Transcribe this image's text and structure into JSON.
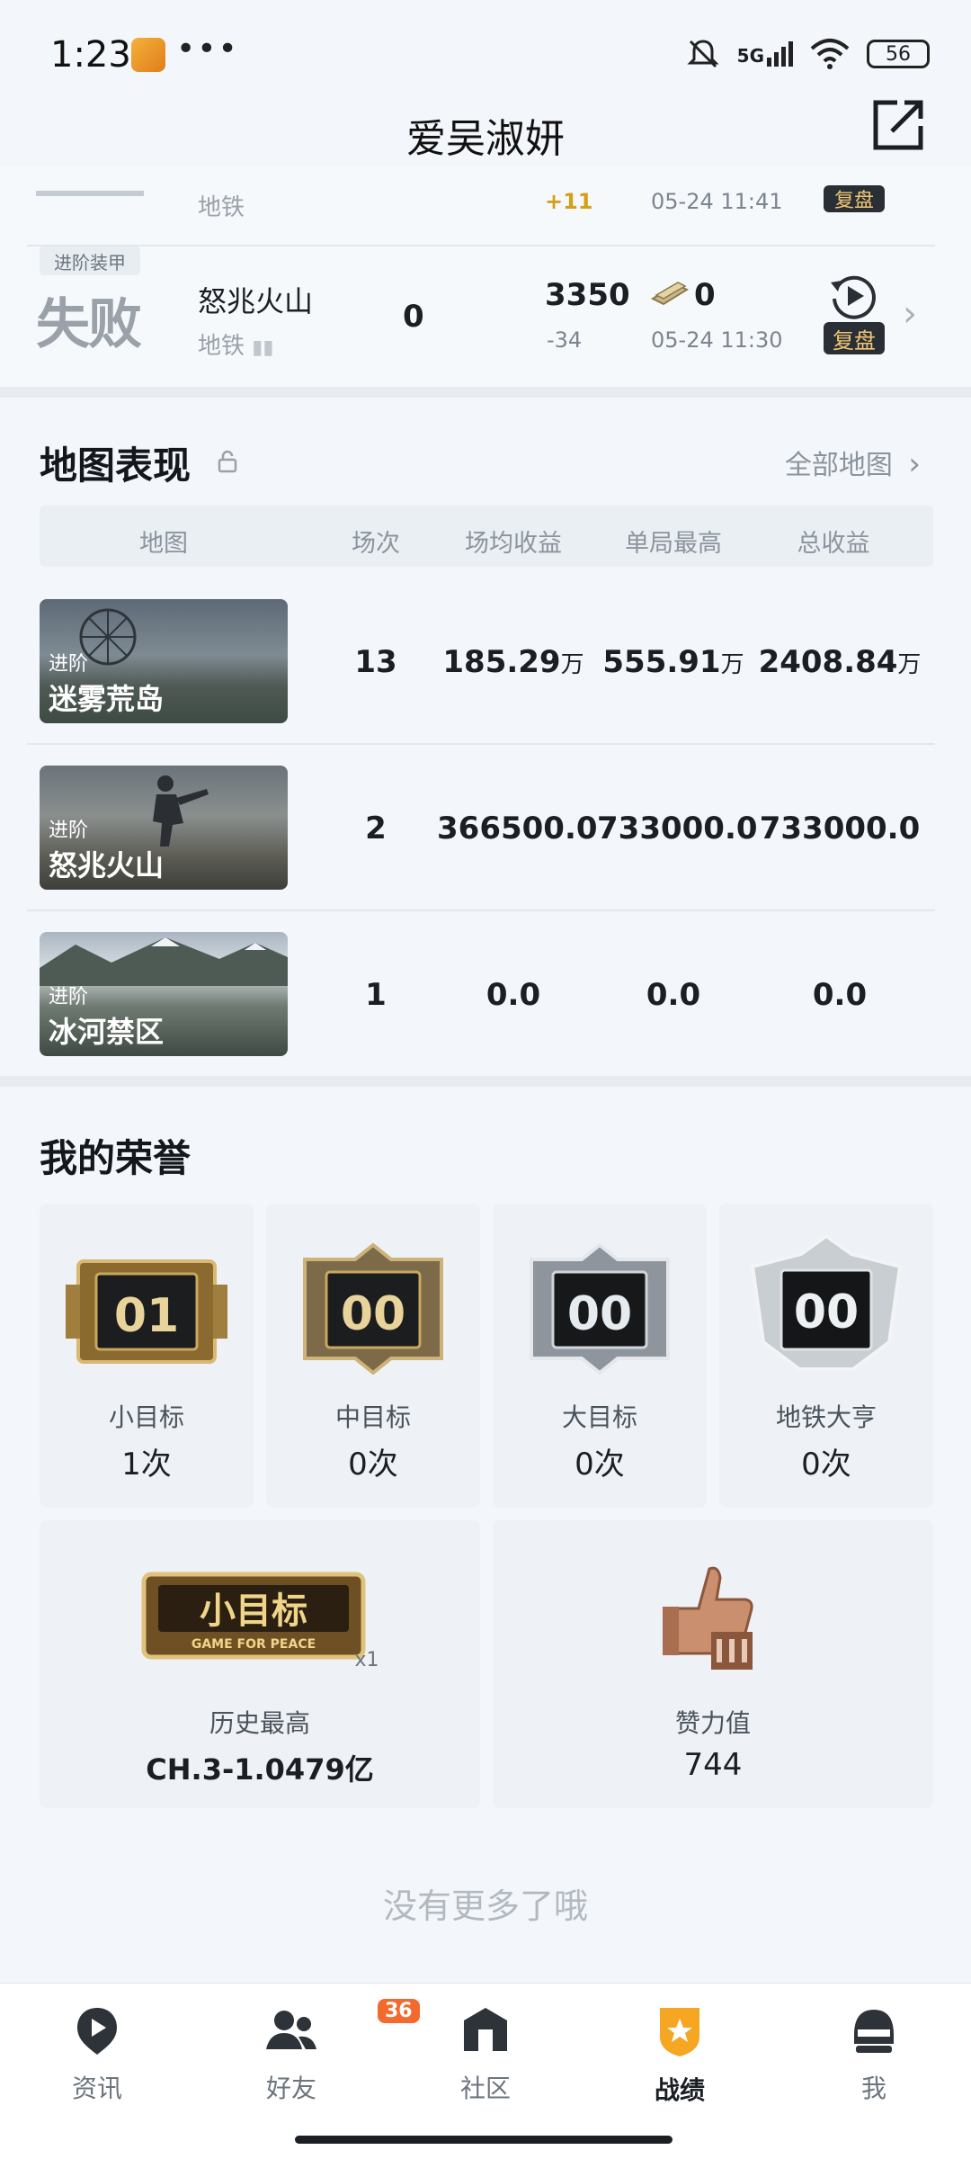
{
  "status_bar": {
    "time": "1:23",
    "dots": "•••",
    "network": "5G",
    "battery": "56"
  },
  "header": {
    "title": "爱吴淑妍"
  },
  "partial_row": {
    "map_sub": "地铁",
    "delta": "+11",
    "time": "05-24 11:41",
    "replay": "复盘"
  },
  "match_row": {
    "mode_tag": "进阶装甲",
    "result": "失败",
    "map_name": "怒兆火山",
    "map_sub": "地铁",
    "kills": "0",
    "score": "3350",
    "score_delta": "-34",
    "money": "0",
    "time": "05-24 11:30",
    "replay": "复盘"
  },
  "map_performance": {
    "title": "地图表现",
    "all_maps": "全部地图",
    "columns": [
      "地图",
      "场次",
      "场均收益",
      "单局最高",
      "总收益"
    ],
    "rows": [
      {
        "tier": "进阶",
        "name": "迷雾荒岛",
        "matches": "13",
        "avg": "185.29",
        "avg_unit": "万",
        "best": "555.91",
        "best_unit": "万",
        "total": "2408.84",
        "total_unit": "万"
      },
      {
        "tier": "进阶",
        "name": "怒兆火山",
        "matches": "2",
        "avg": "366500.0",
        "avg_unit": "",
        "best": "733000.0",
        "best_unit": "",
        "total": "733000.0",
        "total_unit": ""
      },
      {
        "tier": "进阶",
        "name": "冰河禁区",
        "matches": "1",
        "avg": "0.0",
        "avg_unit": "",
        "best": "0.0",
        "best_unit": "",
        "total": "0.0",
        "total_unit": ""
      }
    ]
  },
  "honors": {
    "title": "我的荣誉",
    "badges": [
      {
        "digits": "01",
        "label": "小目标",
        "count": "1次"
      },
      {
        "digits": "00",
        "label": "中目标",
        "count": "0次"
      },
      {
        "digits": "00",
        "label": "大目标",
        "count": "0次"
      },
      {
        "digits": "00",
        "label": "地铁大亨",
        "count": "0次"
      }
    ],
    "history": {
      "badge_text": "小目标",
      "badge_sub": "GAME FOR PEACE",
      "multiplier": "x1",
      "label": "历史最高",
      "value": "CH.3-1.0479亿"
    },
    "likes": {
      "label": "赞力值",
      "value": "744"
    }
  },
  "footer": {
    "no_more": "没有更多了哦"
  },
  "nav": {
    "items": [
      {
        "label": "资讯"
      },
      {
        "label": "好友",
        "badge": "36"
      },
      {
        "label": "社区"
      },
      {
        "label": "战绩"
      },
      {
        "label": "我"
      }
    ],
    "active_color": "#f5a623"
  }
}
